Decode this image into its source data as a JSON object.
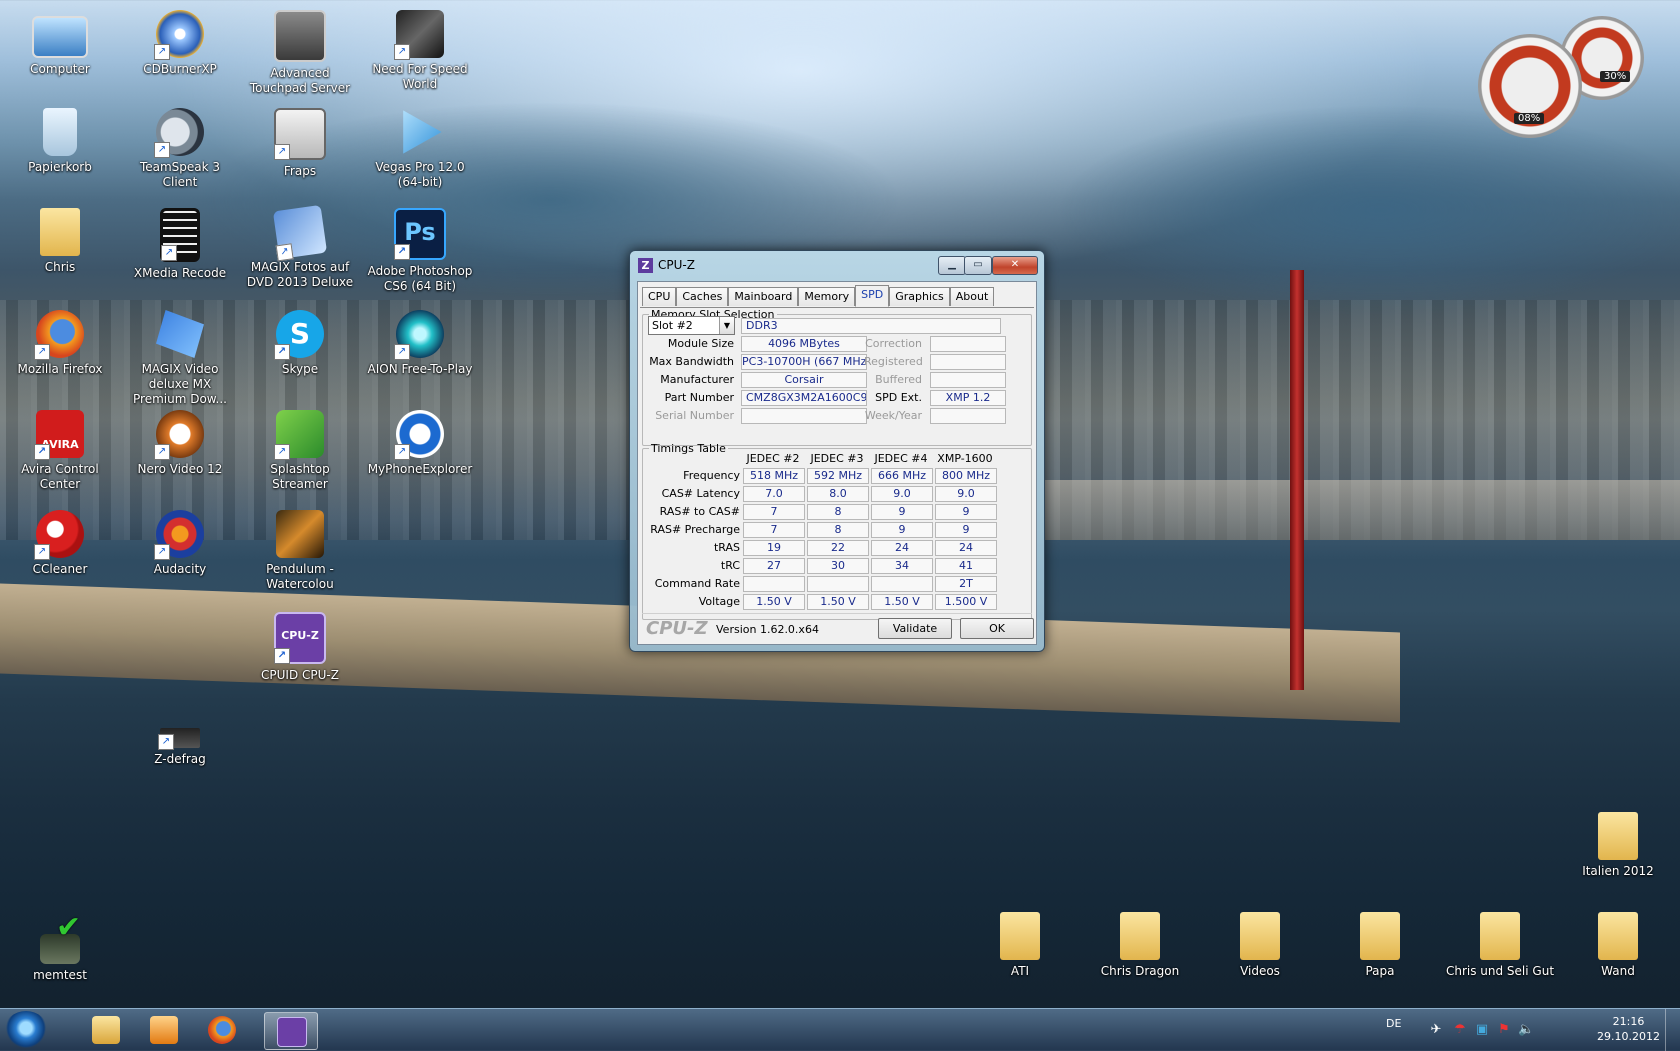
{
  "desktop": {
    "icons": [
      {
        "label": "Computer",
        "icon": "computer-icon"
      },
      {
        "label": "CDBurnerXP",
        "icon": "cd-burner-icon"
      },
      {
        "label": "Advanced Touchpad Server",
        "icon": "touchpad-icon"
      },
      {
        "label": "Need For Speed World",
        "icon": "nfs-icon"
      },
      {
        "label": "Papierkorb",
        "icon": "recycle-bin-icon"
      },
      {
        "label": "TeamSpeak 3 Client",
        "icon": "teamspeak-icon"
      },
      {
        "label": "Fraps",
        "icon": "fraps-icon"
      },
      {
        "label": "Vegas Pro 12.0 (64-bit)",
        "icon": "vegas-icon"
      },
      {
        "label": "Chris",
        "icon": "user-folder-icon"
      },
      {
        "label": "XMedia Recode",
        "icon": "film-icon"
      },
      {
        "label": "MAGIX Fotos auf DVD 2013 Deluxe",
        "icon": "magix-photo-icon"
      },
      {
        "label": "Adobe Photoshop CS6 (64 Bit)",
        "icon": "photoshop-icon"
      },
      {
        "label": "Mozilla Firefox",
        "icon": "firefox-icon"
      },
      {
        "label": "MAGIX Video deluxe MX Premium Dow...",
        "icon": "magix-video-icon"
      },
      {
        "label": "Skype",
        "icon": "skype-icon"
      },
      {
        "label": "AION Free-To-Play",
        "icon": "aion-icon"
      },
      {
        "label": "Avira Control Center",
        "icon": "avira-icon"
      },
      {
        "label": "Nero Video 12",
        "icon": "nero-icon"
      },
      {
        "label": "Splashtop Streamer",
        "icon": "splashtop-icon"
      },
      {
        "label": "MyPhoneExplorer",
        "icon": "myphoneexplorer-icon"
      },
      {
        "label": "CCleaner",
        "icon": "ccleaner-icon"
      },
      {
        "label": "Audacity",
        "icon": "audacity-icon"
      },
      {
        "label": "Pendulum - Watercolou",
        "icon": "pendulum-icon"
      },
      {
        "label": "CPUID CPU-Z",
        "icon": "cpuz-icon"
      },
      {
        "label": "Z-defrag",
        "icon": "chip-icon"
      },
      {
        "label": "memtest",
        "icon": "memtest-icon"
      },
      {
        "label": "Italien 2012",
        "icon": "folder-icon"
      },
      {
        "label": "ATI",
        "icon": "folder-icon"
      },
      {
        "label": "Chris Dragon",
        "icon": "folder-icon"
      },
      {
        "label": "Videos",
        "icon": "folder-icon"
      },
      {
        "label": "Papa",
        "icon": "folder-icon"
      },
      {
        "label": "Chris und Seli Gut",
        "icon": "folder-icon"
      },
      {
        "label": "Wand",
        "icon": "folder-icon"
      }
    ],
    "gadget": {
      "cpu": "08%",
      "ram": "30%"
    }
  },
  "cpuz": {
    "title": "CPU-Z",
    "tabs": [
      "CPU",
      "Caches",
      "Mainboard",
      "Memory",
      "SPD",
      "Graphics",
      "About"
    ],
    "active_tab": "SPD",
    "slot_group": "Memory Slot Selection",
    "slot": "Slot #2",
    "type": "DDR3",
    "labels": {
      "module_size": "Module Size",
      "max_bandwidth": "Max Bandwidth",
      "manufacturer": "Manufacturer",
      "part_number": "Part Number",
      "serial_number": "Serial Number",
      "correction": "Correction",
      "registered": "Registered",
      "buffered": "Buffered",
      "spd_ext": "SPD Ext.",
      "week_year": "Week/Year"
    },
    "values": {
      "module_size": "4096 MBytes",
      "max_bandwidth": "PC3-10700H (667 MHz)",
      "manufacturer": "Corsair",
      "part_number": "CMZ8GX3M2A1600C9",
      "serial_number": "",
      "correction": "",
      "registered": "",
      "buffered": "",
      "spd_ext": "XMP 1.2",
      "week_year": ""
    },
    "timings_group": "Timings Table",
    "columns": [
      "JEDEC #2",
      "JEDEC #3",
      "JEDEC #4",
      "XMP-1600"
    ],
    "rows": [
      {
        "label": "Frequency",
        "values": [
          "518 MHz",
          "592 MHz",
          "666 MHz",
          "800 MHz"
        ]
      },
      {
        "label": "CAS# Latency",
        "values": [
          "7.0",
          "8.0",
          "9.0",
          "9.0"
        ]
      },
      {
        "label": "RAS# to CAS#",
        "values": [
          "7",
          "8",
          "9",
          "9"
        ]
      },
      {
        "label": "RAS# Precharge",
        "values": [
          "7",
          "8",
          "9",
          "9"
        ]
      },
      {
        "label": "tRAS",
        "values": [
          "19",
          "22",
          "24",
          "24"
        ]
      },
      {
        "label": "tRC",
        "values": [
          "27",
          "30",
          "34",
          "41"
        ]
      },
      {
        "label": "Command Rate",
        "values": [
          "",
          "",
          "",
          "2T"
        ]
      },
      {
        "label": "Voltage",
        "values": [
          "1.50 V",
          "1.50 V",
          "1.50 V",
          "1.500 V"
        ]
      }
    ],
    "footer": {
      "logo": "CPU-Z",
      "version": "Version 1.62.0.x64",
      "validate": "Validate",
      "ok": "OK"
    }
  },
  "taskbar": {
    "language": "DE",
    "time": "21:16",
    "date": "29.10.2012"
  }
}
